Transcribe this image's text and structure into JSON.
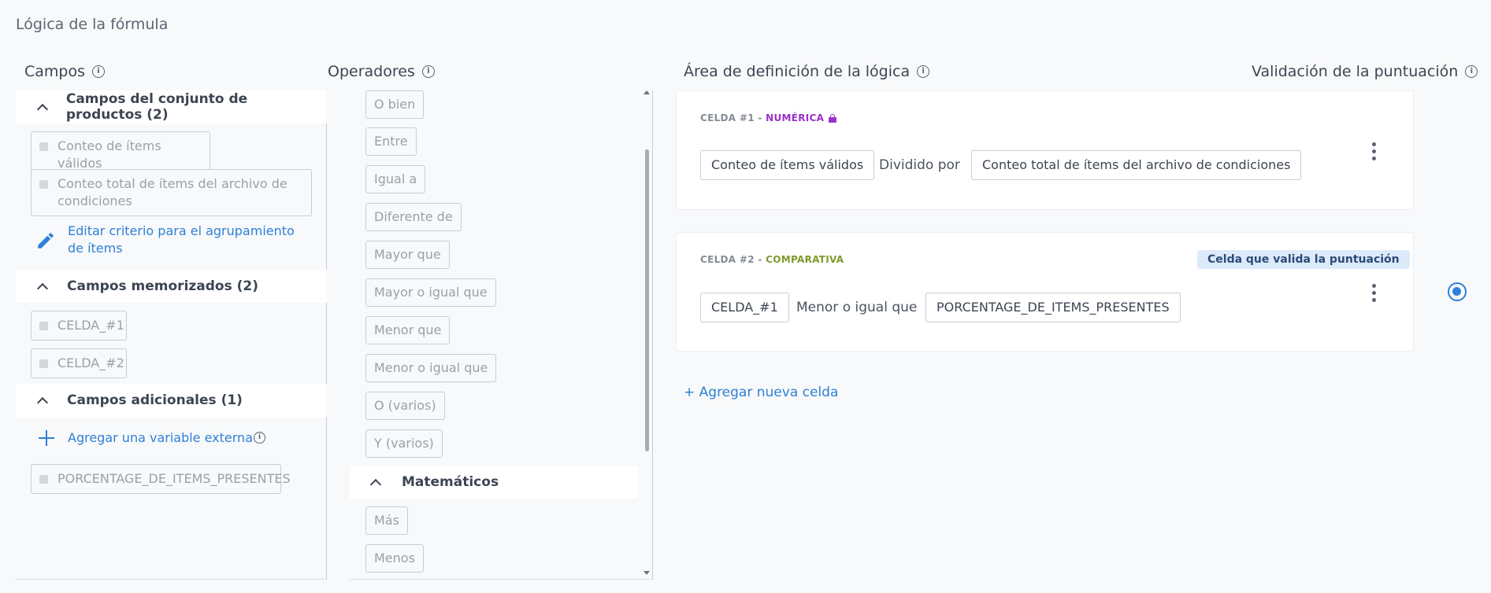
{
  "page_title": "Lógica de la fórmula",
  "columns": {
    "campos": "Campos",
    "operadores": "Operadores",
    "logic_area": "Área de definición de la lógica",
    "validation": "Validación de la puntuación"
  },
  "campos": {
    "product_group": {
      "title": "Campos del conjunto de productos (2)",
      "items": [
        "Conteo de ítems válidos",
        "Conteo total de ítems del archivo de condiciones"
      ],
      "edit_link": "Editar criterio para el agrupamiento de ítems"
    },
    "memorized_group": {
      "title": "Campos memorizados (2)",
      "items": [
        "CELDA_#1",
        "CELDA_#2"
      ]
    },
    "additional_group": {
      "title": "Campos adicionales (1)",
      "add_link": "Agregar una variable externa",
      "items": [
        "PORCENTAGE_DE_ITEMS_PRESENTES"
      ]
    }
  },
  "operadores": {
    "items": [
      "O bien",
      "Entre",
      "Igual a",
      "Diferente de",
      "Mayor que",
      "Mayor o igual que",
      "Menor que",
      "Menor o igual que",
      "O (varios)",
      "Y (varios)"
    ],
    "math_group": {
      "title": "Matemáticos",
      "items": [
        "Más",
        "Menos"
      ]
    }
  },
  "cells": [
    {
      "label": "CELDA #1",
      "separator": " - ",
      "type": "NUMÉRICA",
      "left": "Conteo de ítems válidos",
      "operator": "Dividido por",
      "right": "Conteo total de ítems del archivo de condiciones"
    },
    {
      "label": "CELDA #2",
      "separator": " - ",
      "type": "COMPARATIVA",
      "badge": "Celda que valida la puntuación",
      "left": "CELDA_#1",
      "operator": "Menor o igual que",
      "right": "PORCENTAGE_DE_ITEMS_PRESENTES"
    }
  ],
  "add_cell": "+ Agregar nueva celda",
  "colors": {
    "accent": "#2f80d6",
    "numeric_type": "#9b30c9",
    "comparative_type": "#7e9a2c",
    "badge_bg": "#dceafb"
  }
}
